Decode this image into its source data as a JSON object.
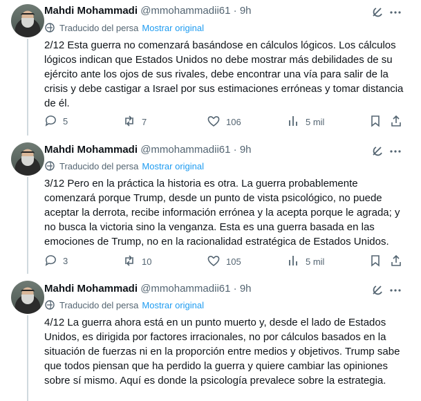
{
  "tweets": [
    {
      "author": "Mahdi Mohammadi",
      "handle": "@mmohammadii61",
      "separator": "·",
      "time": "9h",
      "translated_label": "Traducido del persa",
      "show_original": "Mostrar original",
      "text": "2/12 Esta guerra no comenzará basándose en cálculos lógicos. Los cálculos lógicos indican que Estados Unidos no debe mostrar más debilidades de su ejército ante los ojos de sus rivales, debe encontrar una vía para salir de la crisis y debe castigar a Israel por sus estimaciones erróneas y tomar distancia de él.",
      "replies": "5",
      "reposts": "7",
      "likes": "106",
      "views": "5 mil"
    },
    {
      "author": "Mahdi Mohammadi",
      "handle": "@mmohammadii61",
      "separator": "·",
      "time": "9h",
      "translated_label": "Traducido del persa",
      "show_original": "Mostrar original",
      "text": "3/12 Pero en la práctica la historia es otra. La guerra probablemente comenzará porque Trump, desde un punto de vista psicológico, no puede aceptar la derrota, recibe información errónea y la acepta porque le agrada; y no busca la victoria sino la venganza. Esta es una guerra basada en las emociones de Trump, no en la racionalidad estratégica de Estados Unidos.",
      "replies": "3",
      "reposts": "10",
      "likes": "105",
      "views": "5 mil"
    },
    {
      "author": "Mahdi Mohammadi",
      "handle": "@mmohammadii61",
      "separator": "·",
      "time": "9h",
      "translated_label": "Traducido del persa",
      "show_original": "Mostrar original",
      "text": "4/12 La guerra ahora está en un punto muerto y, desde el lado de Estados Unidos, es dirigida por factores irracionales, no por cálculos basados en la situación de fuerzas ni en la proporción entre medios y objetivos. Trump sabe que todos piensan que ha perdido la guerra y quiere cambiar las opiniones sobre sí mismo. Aquí es donde la psicología prevalece sobre la estrategia."
    }
  ],
  "icons": {
    "grok": "grok-icon",
    "more": "more-icon",
    "translate": "translate-icon",
    "reply": "reply-icon",
    "repost": "repost-icon",
    "like": "like-icon",
    "views": "views-icon",
    "bookmark": "bookmark-icon",
    "share": "share-icon"
  },
  "colors": {
    "link": "#1d9bf0",
    "muted": "#536471",
    "text": "#0f1419",
    "thread_line": "#cfd9de"
  }
}
